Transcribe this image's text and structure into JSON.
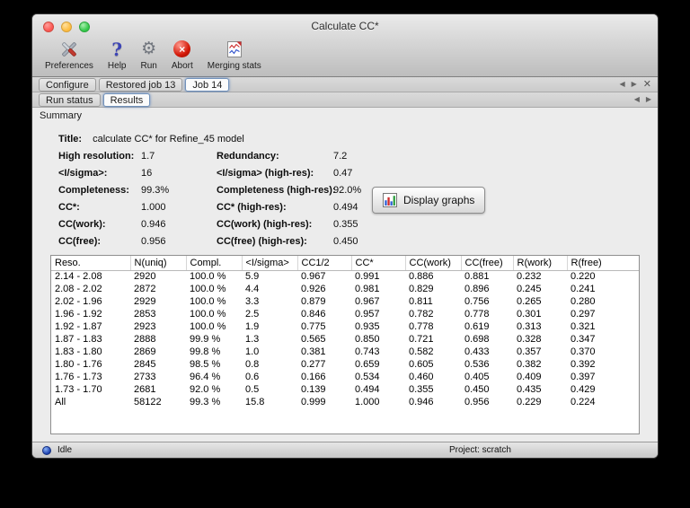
{
  "window": {
    "title": "Calculate CC*"
  },
  "toolbar": {
    "items": [
      {
        "id": "preferences",
        "label": "Preferences"
      },
      {
        "id": "help",
        "label": "Help"
      },
      {
        "id": "run",
        "label": "Run"
      },
      {
        "id": "abort",
        "label": "Abort"
      },
      {
        "id": "merging-stats",
        "label": "Merging stats"
      }
    ]
  },
  "tabs": {
    "main": {
      "items": [
        {
          "label": "Configure",
          "active": false
        },
        {
          "label": "Restored job 13",
          "active": false
        },
        {
          "label": "Job 14",
          "active": true
        }
      ]
    },
    "sub": {
      "items": [
        {
          "label": "Run status",
          "active": false
        },
        {
          "label": "Results",
          "active": true
        }
      ]
    }
  },
  "tab_controls": {
    "prev": "◀",
    "next": "▶",
    "close": "✕"
  },
  "summary": {
    "section_label": "Summary",
    "title_label": "Title:",
    "title_value": "calculate CC* for Refine_45 model",
    "rows": [
      {
        "label1": "High resolution:",
        "value1": "1.7",
        "label2": "Redundancy:",
        "value2": "7.2"
      },
      {
        "label1": "<I/sigma>:",
        "value1": "16",
        "label2": "<I/sigma> (high-res):",
        "value2": "0.47"
      },
      {
        "label1": "Completeness:",
        "value1": "99.3%",
        "label2": "Completeness (high-res):",
        "value2": "92.0%"
      },
      {
        "label1": "CC*:",
        "value1": "1.000",
        "label2": "CC* (high-res):",
        "value2": "0.494"
      },
      {
        "label1": "CC(work):",
        "value1": "0.946",
        "label2": "CC(work) (high-res):",
        "value2": "0.355"
      },
      {
        "label1": "CC(free):",
        "value1": "0.956",
        "label2": "CC(free) (high-res):",
        "value2": "0.450"
      }
    ],
    "display_graphs_label": "Display graphs"
  },
  "table": {
    "headers": [
      "Reso.",
      "N(uniq)",
      "Compl.",
      "<I/sigma>",
      "CC1/2",
      "CC*",
      "CC(work)",
      "CC(free)",
      "R(work)",
      "R(free)"
    ],
    "rows": [
      [
        "2.14 - 2.08",
        "2920",
        "100.0 %",
        "5.9",
        "0.967",
        "0.991",
        "0.886",
        "0.881",
        "0.232",
        "0.220"
      ],
      [
        "2.08 - 2.02",
        "2872",
        "100.0 %",
        "4.4",
        "0.926",
        "0.981",
        "0.829",
        "0.896",
        "0.245",
        "0.241"
      ],
      [
        "2.02 - 1.96",
        "2929",
        "100.0 %",
        "3.3",
        "0.879",
        "0.967",
        "0.811",
        "0.756",
        "0.265",
        "0.280"
      ],
      [
        "1.96 - 1.92",
        "2853",
        "100.0 %",
        "2.5",
        "0.846",
        "0.957",
        "0.782",
        "0.778",
        "0.301",
        "0.297"
      ],
      [
        "1.92 - 1.87",
        "2923",
        "100.0 %",
        "1.9",
        "0.775",
        "0.935",
        "0.778",
        "0.619",
        "0.313",
        "0.321"
      ],
      [
        "1.87 - 1.83",
        "2888",
        "99.9 %",
        "1.3",
        "0.565",
        "0.850",
        "0.721",
        "0.698",
        "0.328",
        "0.347"
      ],
      [
        "1.83 - 1.80",
        "2869",
        "99.8 %",
        "1.0",
        "0.381",
        "0.743",
        "0.582",
        "0.433",
        "0.357",
        "0.370"
      ],
      [
        "1.80 - 1.76",
        "2845",
        "98.5 %",
        "0.8",
        "0.277",
        "0.659",
        "0.605",
        "0.536",
        "0.382",
        "0.392"
      ],
      [
        "1.76 - 1.73",
        "2733",
        "96.4 %",
        "0.6",
        "0.166",
        "0.534",
        "0.460",
        "0.405",
        "0.409",
        "0.397"
      ],
      [
        "1.73 - 1.70",
        "2681",
        "92.0 %",
        "0.5",
        "0.139",
        "0.494",
        "0.355",
        "0.450",
        "0.435",
        "0.429"
      ],
      [
        "All",
        "58122",
        "99.3 %",
        "15.8",
        "0.999",
        "1.000",
        "0.946",
        "0.956",
        "0.229",
        "0.224"
      ]
    ]
  },
  "statusbar": {
    "status": "Idle",
    "project": "Project: scratch"
  }
}
